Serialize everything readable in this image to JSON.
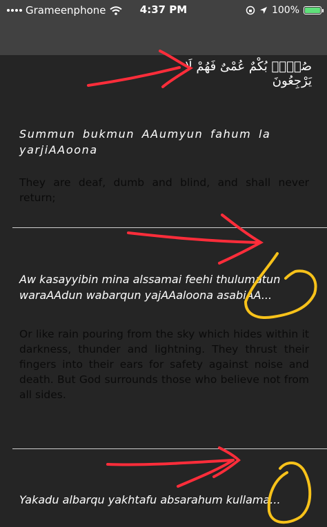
{
  "status_bar": {
    "carrier": "Grameenphone",
    "time": "4:37 PM",
    "battery_percent": "100%",
    "battery_level": 1.0
  },
  "verses": [
    {
      "arabic": "صُمٌّۢ بُكْمٌ عُمْىٌ فَهُمْ لَا يَرْجِعُونَ",
      "transliteration": "Summun bukmun AAumyun fahum la yarjiAAoona",
      "translation": "They are deaf, dumb and blind, and shall never return;"
    },
    {
      "transliteration": "Aw kasayyibin mina alssamai feehi thulumatun waraAAdun wabarqun yajAAaloona asabiAA...",
      "translation": "Or like rain pouring from the sky which hides within it darkness, thunder and lightning. They thrust their fingers into their ears for safety against noise and death. But God surrounds those who believe not from all sides."
    },
    {
      "transliteration": "Yakadu albarqu yakhtafu absarahum kullama..."
    }
  ],
  "colors": {
    "status_bar_bg": "#414141",
    "content_bg": "#252525",
    "annotation_red": "#ff2d3a",
    "annotation_yellow": "#f7c21a"
  }
}
